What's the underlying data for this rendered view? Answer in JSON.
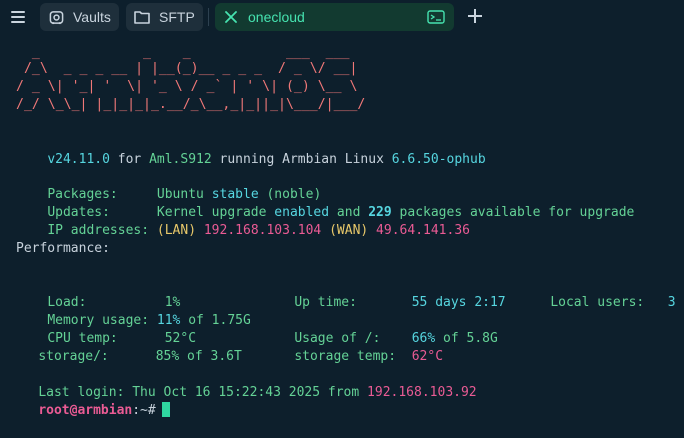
{
  "tabs": [
    {
      "label": "Vaults",
      "icon": "vault-icon"
    },
    {
      "label": "SFTP",
      "icon": "folder-icon"
    },
    {
      "label": "onecloud",
      "icon": "close-icon",
      "active": true,
      "right_icon": "terminal-icon"
    }
  ],
  "terminal": {
    "banner": [
      "  _             _    _            ___  ___ ",
      " /_\\  _ _ _ __ | |__(_)__ _ _ _  / _ \\/ __|",
      "/ _ \\| '_| '  \\| '_ \\ / _` | ' \\| (_) \\__ \\",
      "/_/ \\_\\_| |_|_|_|_.__/_\\__,_|_||_|\\___/|___/"
    ],
    "version_line": {
      "version": "v24.11.0",
      "for": " for ",
      "board": "Aml.S912",
      "running": " running ",
      "distro": "Armbian Linux ",
      "kernel": "6.6.50-ophub"
    },
    "packages": {
      "label": "Packages:     ",
      "distro": "Ubuntu ",
      "status": "stable",
      "codename": " (noble)"
    },
    "updates": {
      "label": "Updates:      ",
      "text1": "Kernel upgrade ",
      "enabled": "enabled",
      "and": " and ",
      "count": "229",
      "text2": " packages available for upgrade"
    },
    "ip": {
      "label": "IP addresses: ",
      "lan_tag": "(LAN)",
      "lan": " 192.168.103.104 ",
      "wan_tag": "(WAN)",
      "wan": " 49.64.141.36"
    },
    "performance": "Performance:",
    "stats": {
      "load_label": "Load:          ",
      "load": "1%",
      "uptime_label": "Up time:       ",
      "uptime": "55 days 2:17",
      "users_label": "Local users:   ",
      "users": "3",
      "mem_label": "Memory usage: ",
      "mem_pct": "11%",
      "mem_of": " of 1.75G",
      "cpu_label": "CPU temp:      ",
      "cpu": "52°C",
      "usage_label": "Usage of /:    ",
      "usage_pct": "66%",
      "usage_of": " of 5.8G",
      "storage_label": "storage/:      ",
      "storage_pct": "85%",
      "storage_of": " of 3.6T",
      "stemp_label": "storage temp:  ",
      "stemp": "62°C"
    },
    "last_login": {
      "text": "Last login: Thu Oct 16 15:22:43 2025 from ",
      "ip": "192.168.103.92"
    },
    "prompt": {
      "user": "root@armbian",
      "path": ":~",
      "symbol": "#"
    }
  }
}
